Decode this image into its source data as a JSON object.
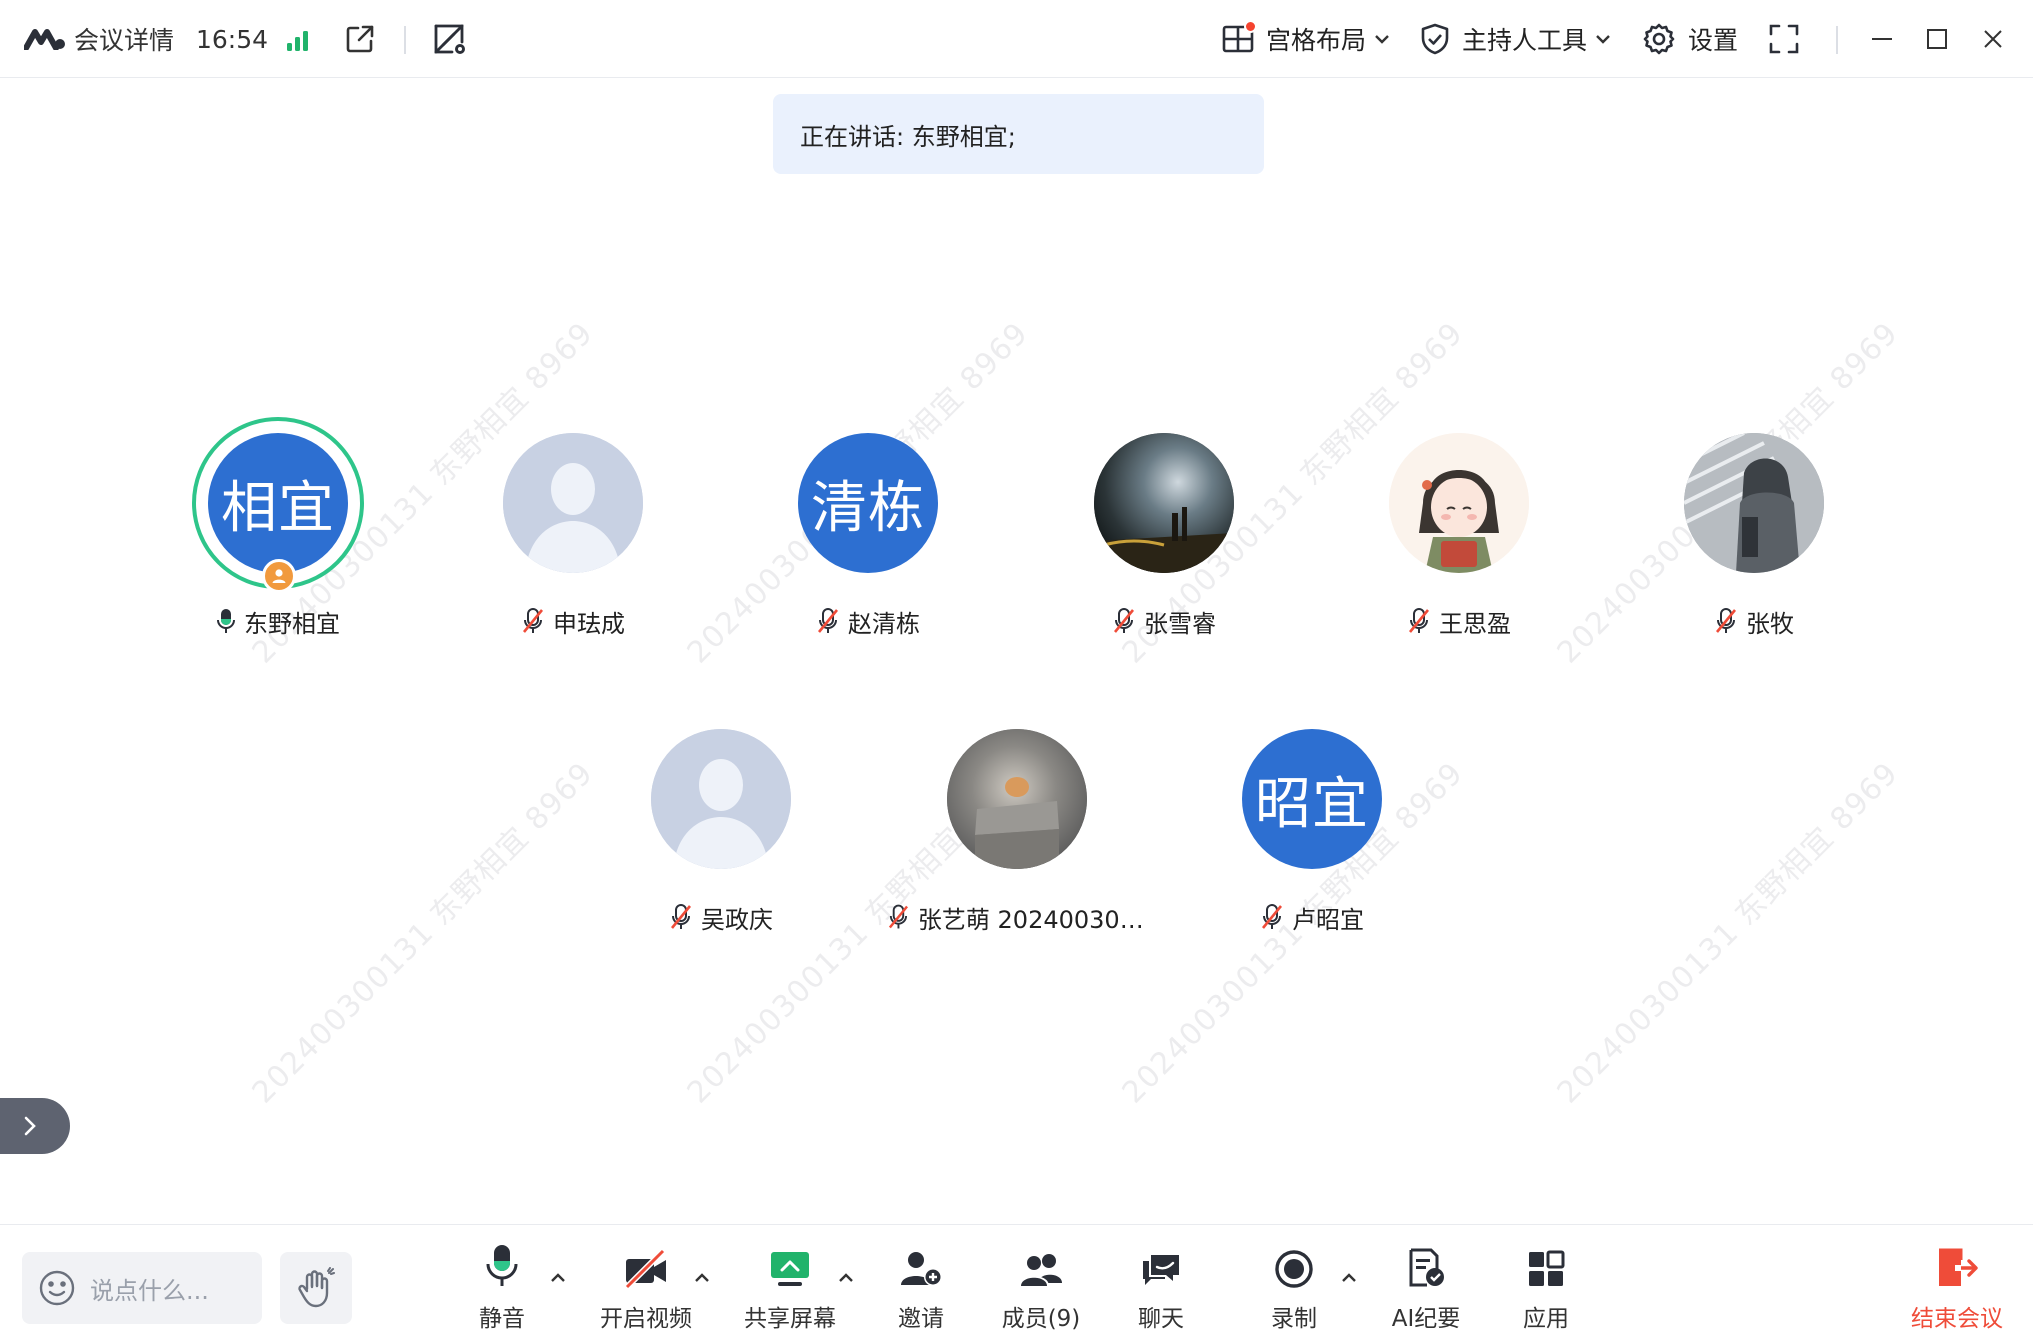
{
  "topbar": {
    "meeting_details": "会议详情",
    "time": "16:54",
    "layout_label": "宫格布局",
    "host_tools_label": "主持人工具",
    "settings_label": "设置"
  },
  "banner": {
    "speaking_text": "正在讲话: 东野相宜;"
  },
  "participants": [
    {
      "name": "东野相宜",
      "initials": "相宜",
      "mic": "on",
      "speaking": true,
      "host": true
    },
    {
      "name": "申珐成",
      "mic": "muted"
    },
    {
      "name": "赵清栋",
      "initials": "清栋",
      "mic": "muted"
    },
    {
      "name": "张雪睿",
      "mic": "muted"
    },
    {
      "name": "王思盈",
      "mic": "muted"
    },
    {
      "name": "张牧",
      "mic": "muted"
    },
    {
      "name": "吴政庆",
      "mic": "muted"
    },
    {
      "name": "张艺萌 202400300...",
      "mic": "muted"
    },
    {
      "name": "卢昭宜",
      "initials": "昭宜",
      "mic": "muted"
    }
  ],
  "watermark": "202400300131 东野相宜 8969",
  "bottombar": {
    "chat_placeholder": "说点什么...",
    "mute": "静音",
    "video": "开启视频",
    "share": "共享屏幕",
    "invite": "邀请",
    "members": "成员(9)",
    "chat": "聊天",
    "record": "录制",
    "ai_minutes": "AI纪要",
    "apps": "应用",
    "end": "结束会议"
  },
  "colors": {
    "accent_blue": "#2d6fd1",
    "speaking_green": "#2ec58a",
    "mute_red": "#ef4c39",
    "signal_green": "#21b36b",
    "host_orange": "#f19a3e",
    "banner_bg": "#eaf1fd"
  }
}
